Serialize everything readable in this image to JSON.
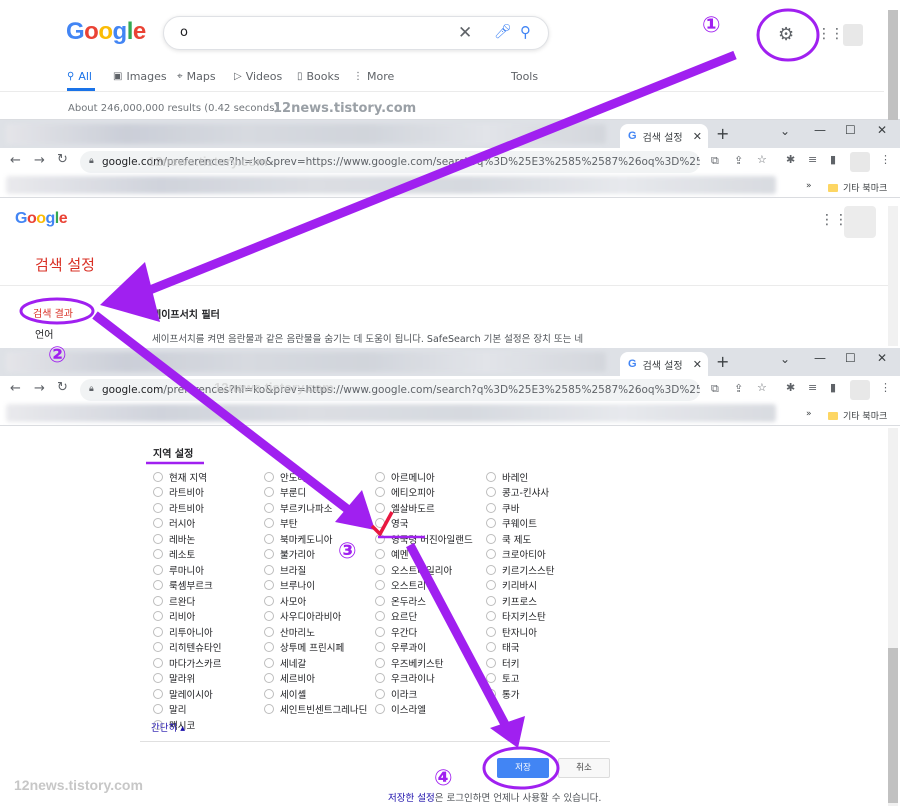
{
  "panel1": {
    "logo": "Google",
    "query": "o",
    "tabs": [
      {
        "label": "All",
        "icon": "search-icon"
      },
      {
        "label": "Images",
        "icon": "image-icon"
      },
      {
        "label": "Maps",
        "icon": "pin-icon"
      },
      {
        "label": "Videos",
        "icon": "play-icon"
      },
      {
        "label": "Books",
        "icon": "book-icon"
      },
      {
        "label": "More",
        "icon": "dots-icon"
      }
    ],
    "tools": "Tools",
    "result_stats": "About 246,000,000 results (0.42 seconds)",
    "watermark": "12news.tistory.com"
  },
  "browser": {
    "tab_title": "검색 설정",
    "url_domain": "google.com",
    "url_rest_1": "/preferences?hl=ko&prev=https://www.google.com/search?q%3D%25E3%2585%2587%26oq%3D%25E3%",
    "url_rest_2": "/preferences?hl=ko&prev=https://www.google.com/search?q%3D%25E3%2585%2587%26oq%3D%25E3%2585%",
    "bookmark_folder": "기타 북마크",
    "bookmark_more": "»"
  },
  "panel2": {
    "logo": "Google",
    "title": "검색 설정",
    "nav_items": [
      "검색 결과",
      "언어"
    ],
    "section_heading": "세이프서치 필터",
    "section_desc": "세이프서치를 켜면 음란물과 같은 음란물을 숨기는 데 도움이 됩니다. SafeSearch 기본 설정은 장치 또는 네"
  },
  "panel3": {
    "region_heading": "지역 설정",
    "columns": [
      [
        "현재 지역",
        "라트비아",
        "라트비아",
        "러시아",
        "레바논",
        "레소토",
        "루마니아",
        "룩셈부르크",
        "르완다",
        "리비아",
        "리투아니아",
        "리히텐슈타인",
        "마다가스카르",
        "말라위",
        "말레이시아",
        "말리",
        "멕시코"
      ],
      [
        "안도라",
        "부룬디",
        "부르키나파소",
        "부탄",
        "북마케도니아",
        "불가리아",
        "브라질",
        "브루나이",
        "사모아",
        "사우디아라비아",
        "산마리노",
        "상투메 프린시페",
        "세네갈",
        "세르비아",
        "세이셸",
        "세인트빈센트그레나딘"
      ],
      [
        "아르메니아",
        "에티오피아",
        "엘살바도르",
        "영국",
        "영국령 버진아일랜드",
        "예멘",
        "오스트레일리아",
        "오스트리아",
        "온두라스",
        "요르단",
        "우간다",
        "우루과이",
        "우즈베키스탄",
        "우크라이나",
        "이라크",
        "이스라엘"
      ],
      [
        "바레인",
        "콩고-킨샤사",
        "쿠바",
        "쿠웨이트",
        "쿡 제도",
        "크로아티아",
        "키르기스스탄",
        "키리바시",
        "키프로스",
        "타지키스탄",
        "탄자니아",
        "태국",
        "터키",
        "토고",
        "통가"
      ]
    ],
    "collapse": "간단히 ▴",
    "save": "저장",
    "cancel": "취소",
    "note_link": "저장한 설정",
    "note_rest": "은 로그인하면 언제나 사용할 수 있습니다."
  },
  "annotations": {
    "steps": [
      "①",
      "②",
      "③",
      "④"
    ],
    "mark_color": "#a020f0",
    "check_color": "#e8173f",
    "watermark": "12news.tistory.com"
  }
}
